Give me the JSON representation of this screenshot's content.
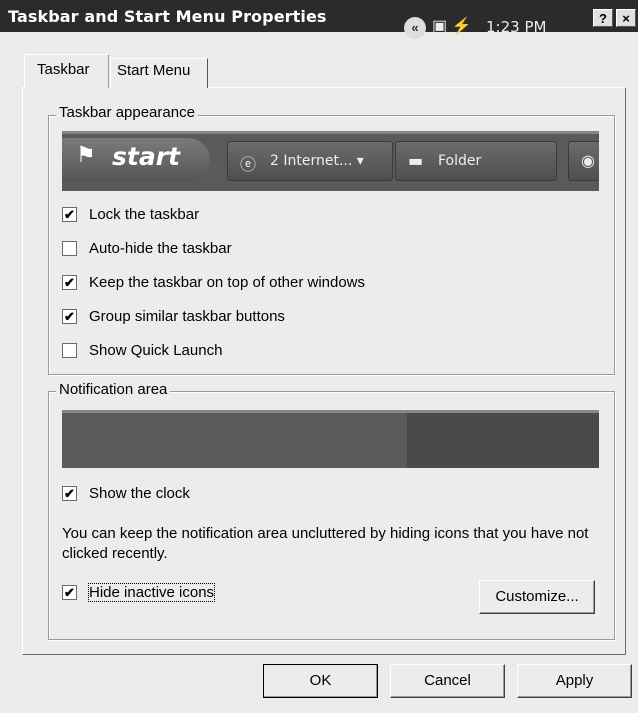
{
  "window": {
    "title": "Taskbar and Start Menu Properties",
    "help_label": "?",
    "close_label": "×"
  },
  "tabs": [
    {
      "label": "Taskbar",
      "selected": true
    },
    {
      "label": "Start Menu",
      "selected": false
    }
  ],
  "taskbar_appearance": {
    "legend": "Taskbar appearance",
    "preview": {
      "start_label": "start",
      "ie_button_label": "2 Internet... ▾",
      "folder_button_label": "Folder"
    },
    "options": [
      {
        "label": "Lock the taskbar",
        "checked": true
      },
      {
        "label": "Auto-hide the taskbar",
        "checked": false
      },
      {
        "label": "Keep the taskbar on top of other windows",
        "checked": true
      },
      {
        "label": "Group similar taskbar buttons",
        "checked": true
      },
      {
        "label": "Show Quick Launch",
        "checked": false
      }
    ]
  },
  "notification_area": {
    "legend": "Notification area",
    "preview": {
      "clock_text": "1:23 PM"
    },
    "show_clock": {
      "label": "Show the clock",
      "checked": true
    },
    "description": "You can keep the notification area uncluttered by hiding icons that you have not clicked recently.",
    "hide_inactive": {
      "label": "Hide inactive icons",
      "checked": true
    },
    "customize_label": "Customize..."
  },
  "footer": {
    "ok_label": "OK",
    "cancel_label": "Cancel",
    "apply_label": "Apply"
  }
}
